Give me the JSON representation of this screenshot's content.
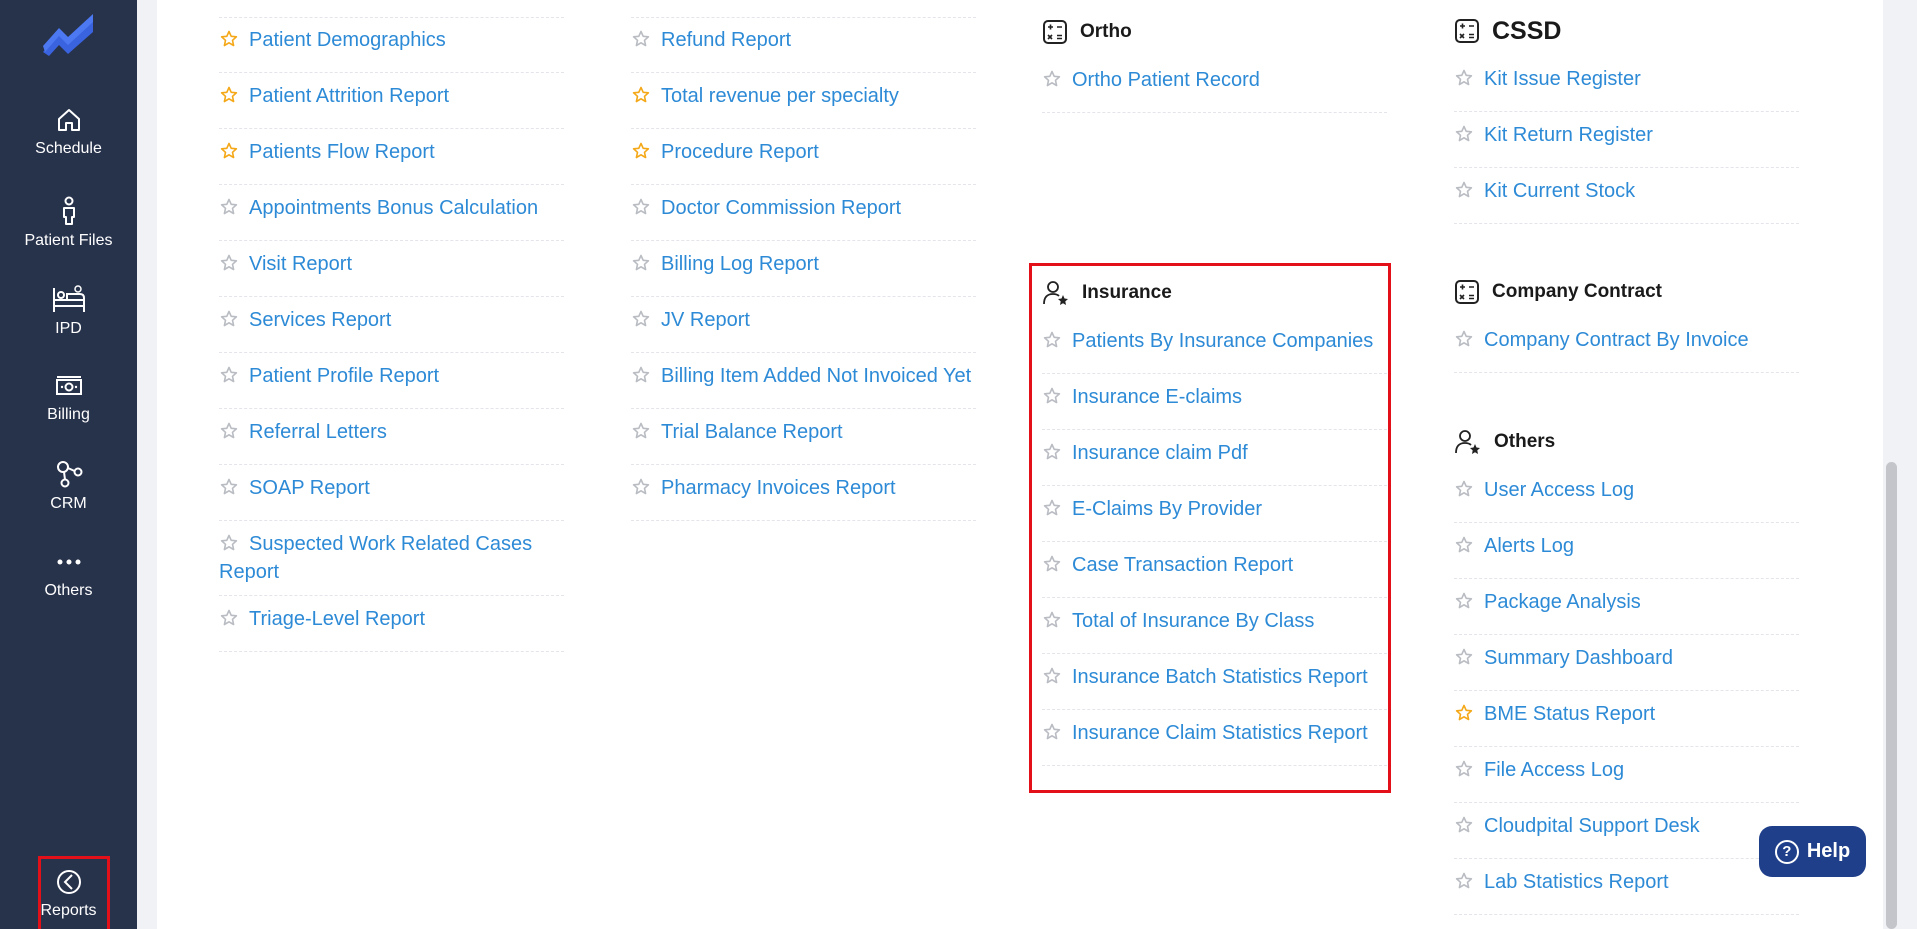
{
  "sidebar": {
    "items": [
      {
        "label": "Schedule",
        "icon": "home-icon"
      },
      {
        "label": "Patient Files",
        "icon": "patient-icon"
      },
      {
        "label": "IPD",
        "icon": "bed-icon"
      },
      {
        "label": "Billing",
        "icon": "money-icon"
      },
      {
        "label": "CRM",
        "icon": "network-icon"
      },
      {
        "label": "Others",
        "icon": "more-icon"
      },
      {
        "label": "Reports",
        "icon": "pie-chart-icon"
      }
    ]
  },
  "colors": {
    "sidebar_bg": "#27324b",
    "link": "#2d8ad6",
    "star_favorite": "#f4a818",
    "star_default": "#b9bcc2",
    "highlight_box": "#e3101a",
    "help_button": "#1f3f8a"
  },
  "columns": {
    "col1": {
      "items": [
        {
          "label": "Patient Demographics",
          "favorite": true
        },
        {
          "label": "Patient Attrition Report",
          "favorite": true
        },
        {
          "label": "Patients Flow Report",
          "favorite": true
        },
        {
          "label": "Appointments Bonus Calculation",
          "favorite": false
        },
        {
          "label": "Visit Report",
          "favorite": false
        },
        {
          "label": "Services Report",
          "favorite": false
        },
        {
          "label": "Patient Profile Report",
          "favorite": false
        },
        {
          "label": "Referral Letters",
          "favorite": false
        },
        {
          "label": "SOAP Report",
          "favorite": false
        },
        {
          "label": "Suspected Work Related Cases Report",
          "favorite": false
        },
        {
          "label": "Triage-Level Report",
          "favorite": false
        }
      ]
    },
    "col2": {
      "items": [
        {
          "label": "Refund Report",
          "favorite": false
        },
        {
          "label": "Total revenue per specialty",
          "favorite": true
        },
        {
          "label": "Procedure Report",
          "favorite": true
        },
        {
          "label": "Doctor Commission Report",
          "favorite": false
        },
        {
          "label": "Billing Log Report",
          "favorite": false
        },
        {
          "label": "JV Report",
          "favorite": false
        },
        {
          "label": "Billing Item Added Not Invoiced Yet",
          "favorite": false
        },
        {
          "label": "Trial Balance Report",
          "favorite": false
        },
        {
          "label": "Pharmacy Invoices Report",
          "favorite": false
        }
      ]
    },
    "ortho": {
      "title": "Ortho",
      "items": [
        {
          "label": "Ortho Patient Record",
          "favorite": false
        }
      ]
    },
    "insurance": {
      "title": "Insurance",
      "items": [
        {
          "label": "Patients By Insurance Companies",
          "favorite": false
        },
        {
          "label": "Insurance E-claims",
          "favorite": false
        },
        {
          "label": "Insurance claim Pdf",
          "favorite": false
        },
        {
          "label": "E-Claims By Provider",
          "favorite": false
        },
        {
          "label": "Case Transaction Report",
          "favorite": false
        },
        {
          "label": "Total of Insurance By Class",
          "favorite": false
        },
        {
          "label": "Insurance Batch Statistics Report",
          "favorite": false
        },
        {
          "label": "Insurance Claim Statistics Report",
          "favorite": false
        }
      ]
    },
    "cssd": {
      "title": "CSSD",
      "items": [
        {
          "label": "Kit Issue Register",
          "favorite": false
        },
        {
          "label": "Kit Return Register",
          "favorite": false
        },
        {
          "label": "Kit Current Stock",
          "favorite": false
        }
      ]
    },
    "company_contract": {
      "title": "Company Contract",
      "items": [
        {
          "label": "Company Contract By Invoice",
          "favorite": false
        }
      ]
    },
    "others": {
      "title": "Others",
      "items": [
        {
          "label": "User Access Log",
          "favorite": false
        },
        {
          "label": "Alerts Log",
          "favorite": false
        },
        {
          "label": "Package Analysis",
          "favorite": false
        },
        {
          "label": "Summary Dashboard",
          "favorite": false
        },
        {
          "label": "BME Status Report",
          "favorite": true
        },
        {
          "label": "File Access Log",
          "favorite": false
        },
        {
          "label": "Cloudpital Support Desk",
          "favorite": false
        },
        {
          "label": "Lab Statistics Report",
          "favorite": false
        }
      ]
    }
  },
  "help": {
    "label": "Help"
  }
}
